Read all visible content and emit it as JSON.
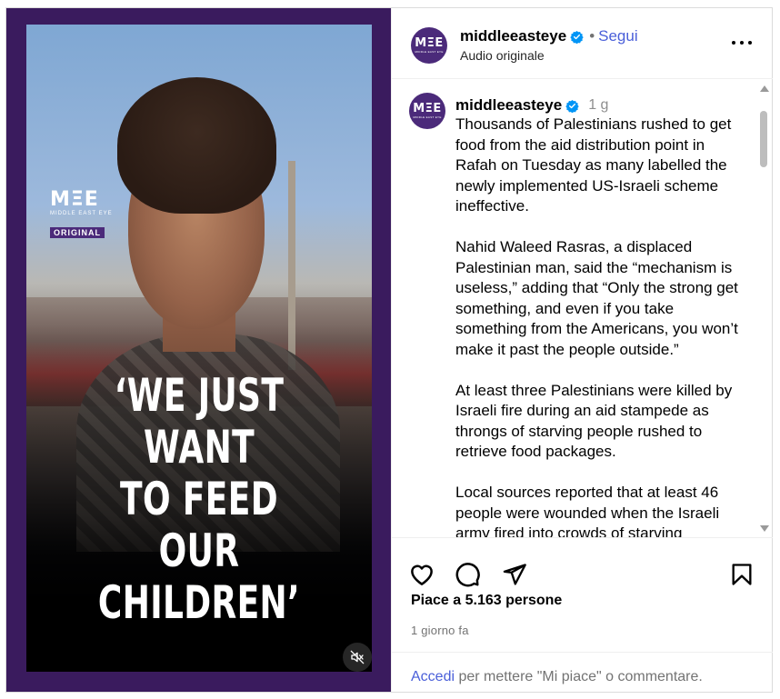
{
  "video": {
    "logo_big": "MΞE",
    "logo_small": "MIDDLE EAST EYE",
    "badge": "ORIGINAL",
    "headline_lines": [
      "‘WE JUST WANT",
      "TO FEED",
      "OUR CHILDREN’"
    ],
    "mute_icon": "speaker-muted-icon"
  },
  "header": {
    "avatar_big": "MΞE",
    "avatar_small": "MIDDLE EAST EYE",
    "username": "middleeasteye",
    "separator": "•",
    "follow_label": "Segui",
    "subtitle": "Audio originale",
    "more_icon": "more-options-icon"
  },
  "caption": {
    "username": "middleeasteye",
    "time": "1 g",
    "paragraphs": [
      "Thousands of Palestinians rushed to get food from the aid distribution point in Rafah on Tuesday as many labelled the newly implemented US-Israeli scheme ineffective.",
      "Nahid Waleed Rasras, a displaced Palestinian man, said the “mechanism is useless,” adding that “Only the strong get something, and even if you take something from the Americans, you won’t make it past the people outside.”",
      "At least three Palestinians were killed by Israeli fire during an aid stampede as throngs of starving people rushed to retrieve food packages.",
      "Local sources reported that at least 46 people were wounded when the Israeli army fired into crowds of starving"
    ]
  },
  "actions": {
    "icons": [
      "heart-icon",
      "comment-icon",
      "share-icon",
      "bookmark-icon"
    ],
    "likes": "Piace a 5.163 persone",
    "time_ago": "1 giorno fa",
    "login_link": "Accedi",
    "login_rest": " per mettere \"Mi piace\" o commentare."
  },
  "colors": {
    "brand_purple": "#4b2a7a",
    "link_blue": "#4a5fd9",
    "verified_blue": "#0095f6"
  }
}
